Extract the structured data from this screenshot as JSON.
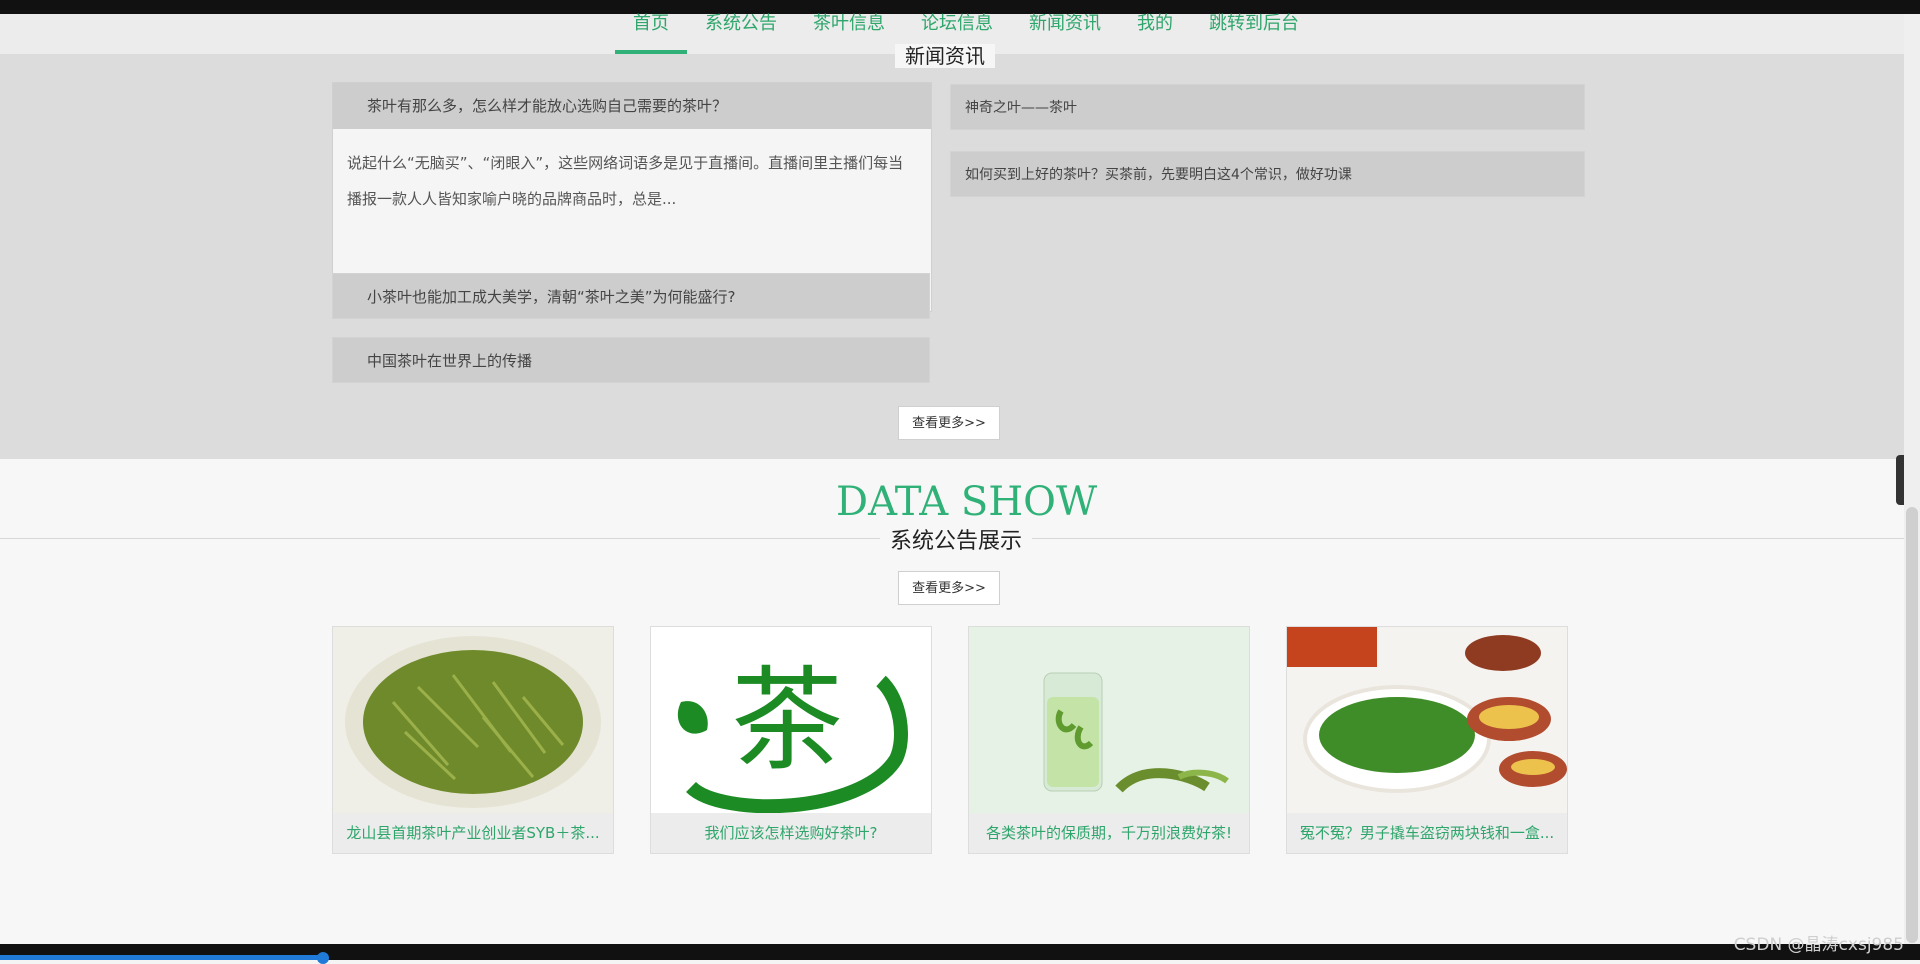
{
  "nav": {
    "items": [
      "首页",
      "系统公告",
      "茶叶信息",
      "论坛信息",
      "新闻资讯",
      "我的",
      "跳转到后台"
    ]
  },
  "news": {
    "title": "新闻资讯",
    "main_card": {
      "title": "茶叶有那么多，怎么样才能放心选购自己需要的茶叶？",
      "excerpt": "说起什么“无脑买”、“闭眼入”，这些网络词语多是见于直播间。直播间里主播们每当播报一款人人皆知家喻户晓的品牌商品时，总是..."
    },
    "left_items": [
      "小茶叶也能加工成大美学，清朝“茶叶之美”为何能盛行?",
      "中国茶叶在世界上的传播"
    ],
    "right_items": [
      "神奇之叶——茶叶",
      "如何买到上好的茶叶？买茶前，先要明白这4个常识，做好功课"
    ],
    "more_button": "查看更多>>"
  },
  "data_show": {
    "title": "DATA SHOW",
    "subtitle": "系统公告展示",
    "more_button": "查看更多>>",
    "cards": [
      {
        "caption": "龙山县首期茶叶产业创业者SYB＋茶..."
      },
      {
        "caption": "我们应该怎样选购好茶叶?"
      },
      {
        "caption": "各类茶叶的保质期，千万别浪费好茶!"
      },
      {
        "caption": "冤不冤？男子撬车盗窃两块钱和一盒..."
      }
    ]
  },
  "watermark": "CSDN @晶涛cxsj985",
  "colors": {
    "brand_green": "#2fb178"
  }
}
